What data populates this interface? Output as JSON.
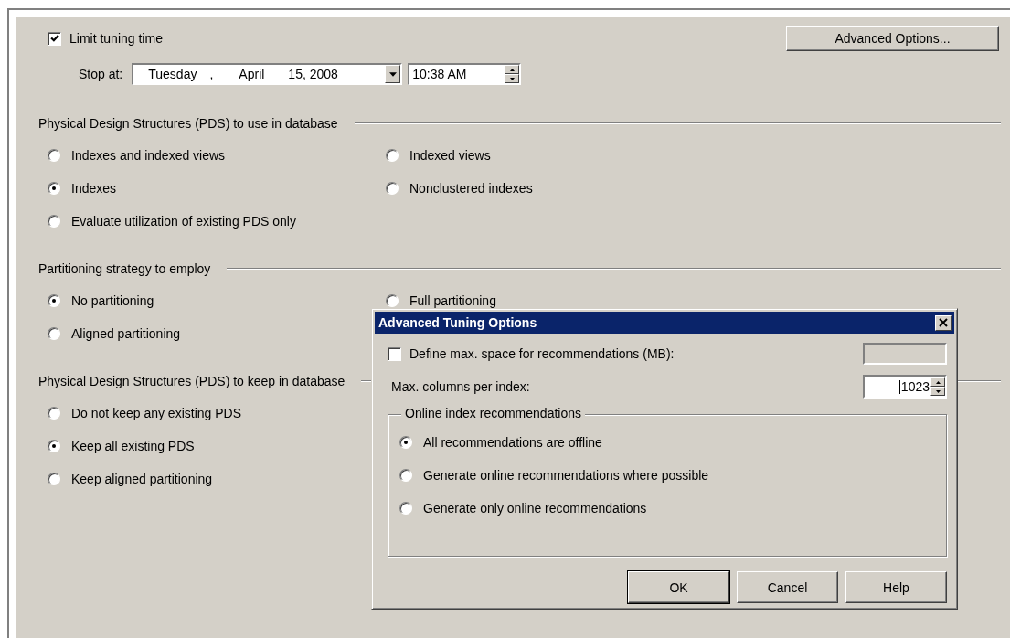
{
  "limit_tuning_time": {
    "label": "Limit tuning time",
    "checked": true
  },
  "advanced_options_button": "Advanced Options...",
  "stop_at": {
    "label": "Stop at:",
    "weekday": "Tuesday",
    "separator": ",",
    "month": "April",
    "day_year": "15, 2008",
    "time": "10:38 AM"
  },
  "sections": [
    {
      "title": "Physical Design Structures (PDS) to use in database",
      "rows": [
        [
          {
            "label": "Indexes and indexed views",
            "selected": false
          },
          {
            "label": "Indexed views",
            "selected": false
          }
        ],
        [
          {
            "label": "Indexes",
            "selected": true
          },
          {
            "label": "Nonclustered indexes",
            "selected": false
          }
        ],
        [
          {
            "label": "Evaluate utilization of existing PDS only",
            "selected": false
          }
        ]
      ]
    },
    {
      "title": "Partitioning strategy to employ",
      "rows": [
        [
          {
            "label": "No partitioning",
            "selected": true
          },
          {
            "label": "Full partitioning",
            "selected": false
          }
        ],
        [
          {
            "label": "Aligned partitioning",
            "selected": false
          }
        ]
      ]
    },
    {
      "title": "Physical Design Structures (PDS) to keep in database",
      "rows": [
        [
          {
            "label": "Do not keep any existing PDS",
            "selected": false
          }
        ],
        [
          {
            "label": "Keep all existing PDS",
            "selected": true
          }
        ],
        [
          {
            "label": "Keep aligned partitioning",
            "selected": false
          }
        ]
      ]
    }
  ],
  "dialog": {
    "title": "Advanced Tuning Options",
    "max_space": {
      "label": "Define max. space for recommendations (MB):",
      "checked": false
    },
    "max_columns": {
      "label": "Max. columns per index:",
      "value": "1023"
    },
    "online_group": {
      "title": "Online index recommendations",
      "options": [
        {
          "label": "All recommendations are offline",
          "selected": true
        },
        {
          "label": "Generate online recommendations where possible",
          "selected": false
        },
        {
          "label": "Generate only online recommendations",
          "selected": false
        }
      ]
    },
    "buttons": [
      {
        "label": "OK",
        "default": true
      },
      {
        "label": "Cancel",
        "default": false
      },
      {
        "label": "Help",
        "default": false
      }
    ]
  }
}
